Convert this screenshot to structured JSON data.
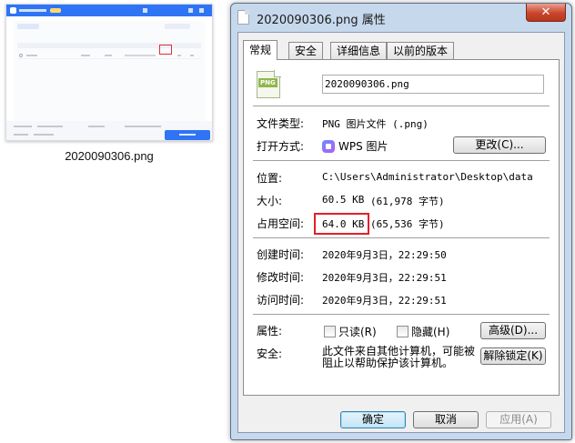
{
  "desktop": {
    "file_caption": "2020090306.png"
  },
  "dialog": {
    "title": "2020090306.png 属性",
    "close_glyph": "✕",
    "tabs": [
      "常规",
      "安全",
      "详细信息",
      "以前的版本"
    ],
    "active_tab": "常规",
    "file_icon_label": "PNG",
    "file_name": "2020090306.png",
    "file_type_label": "文件类型:",
    "file_type_value": "PNG 图片文件 (.png)",
    "opens_with_label": "打开方式:",
    "opens_with_value": "WPS 图片",
    "change_button": "更改(C)...",
    "location_label": "位置:",
    "location_value": "C:\\Users\\Administrator\\Desktop\\data",
    "size_label": "大小:",
    "size_value": "60.5 KB",
    "size_bytes": "(61,978 字节)",
    "disk_size_label": "占用空间:",
    "disk_size_value": "64.0 KB (65,536 字节)",
    "created_label": "创建时间:",
    "created_value": "2020年9月3日，22:29:50",
    "modified_label": "修改时间:",
    "modified_value": "2020年9月3日，22:29:51",
    "accessed_label": "访问时间:",
    "accessed_value": "2020年9月3日，22:29:51",
    "attributes_label": "属性:",
    "readonly_label": "只读(R)",
    "hidden_label": "隐藏(H)",
    "advanced_button": "高级(D)...",
    "security_label": "安全:",
    "security_text": "此文件来自其他计算机，可能被阻止以帮助保护该计算机。",
    "unblock_button": "解除锁定(K)",
    "ok_button": "确定",
    "cancel_button": "取消",
    "apply_button": "应用(A)"
  }
}
